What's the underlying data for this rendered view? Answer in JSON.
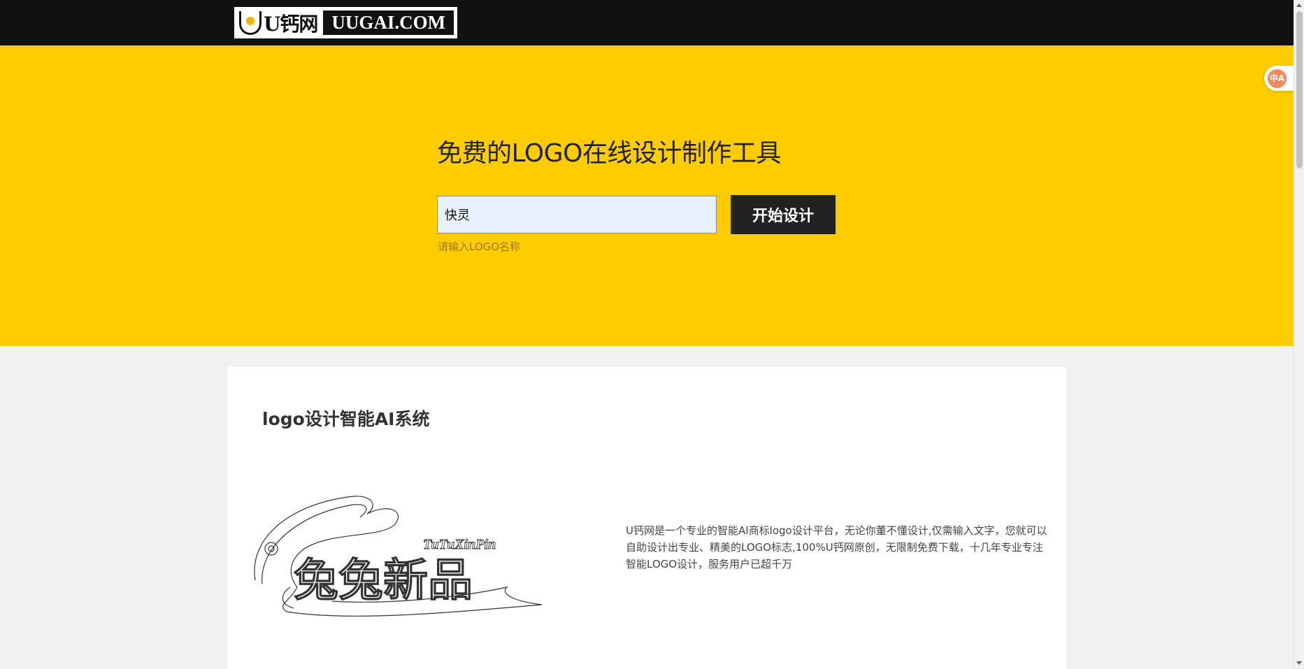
{
  "header": {
    "logo_cn": "U钙网",
    "logo_en": "UUGAI.COM"
  },
  "hero": {
    "title": "免费的LOGO在线设计制作工具",
    "input_value": "快灵",
    "button_label": "开始设计",
    "hint": "请输入LOGO名称"
  },
  "translate": {
    "icon": "translate-icon",
    "label": "中A"
  },
  "intro": {
    "title": "logo设计智能AI系统",
    "sample_logo_cn": "兔兔新品",
    "sample_logo_en": "TuTuXinPin",
    "description": "U钙网是一个专业的智能AI商标logo设计平台，无论你董不懂设计,仅需输入文字，您就可以自助设计出专业、精美的LOGO标志,100%U钙网原创，无限制免费下载，十几年专业专注智能LOGO设计，服务用户已超千万"
  },
  "colors": {
    "hero_bg": "#ffcc00",
    "topbar_bg": "#111111",
    "button_bg": "#222222",
    "input_bg": "#e8f0fe"
  }
}
